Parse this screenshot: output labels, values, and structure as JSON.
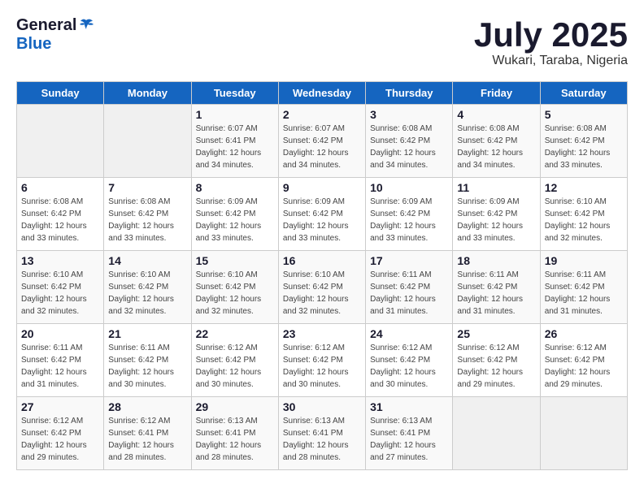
{
  "header": {
    "logo_general": "General",
    "logo_blue": "Blue",
    "month_year": "July 2025",
    "location": "Wukari, Taraba, Nigeria"
  },
  "days_of_week": [
    "Sunday",
    "Monday",
    "Tuesday",
    "Wednesday",
    "Thursday",
    "Friday",
    "Saturday"
  ],
  "weeks": [
    [
      {
        "day": "",
        "info": ""
      },
      {
        "day": "",
        "info": ""
      },
      {
        "day": "1",
        "info": "Sunrise: 6:07 AM\nSunset: 6:41 PM\nDaylight: 12 hours\nand 34 minutes."
      },
      {
        "day": "2",
        "info": "Sunrise: 6:07 AM\nSunset: 6:42 PM\nDaylight: 12 hours\nand 34 minutes."
      },
      {
        "day": "3",
        "info": "Sunrise: 6:08 AM\nSunset: 6:42 PM\nDaylight: 12 hours\nand 34 minutes."
      },
      {
        "day": "4",
        "info": "Sunrise: 6:08 AM\nSunset: 6:42 PM\nDaylight: 12 hours\nand 34 minutes."
      },
      {
        "day": "5",
        "info": "Sunrise: 6:08 AM\nSunset: 6:42 PM\nDaylight: 12 hours\nand 33 minutes."
      }
    ],
    [
      {
        "day": "6",
        "info": "Sunrise: 6:08 AM\nSunset: 6:42 PM\nDaylight: 12 hours\nand 33 minutes."
      },
      {
        "day": "7",
        "info": "Sunrise: 6:08 AM\nSunset: 6:42 PM\nDaylight: 12 hours\nand 33 minutes."
      },
      {
        "day": "8",
        "info": "Sunrise: 6:09 AM\nSunset: 6:42 PM\nDaylight: 12 hours\nand 33 minutes."
      },
      {
        "day": "9",
        "info": "Sunrise: 6:09 AM\nSunset: 6:42 PM\nDaylight: 12 hours\nand 33 minutes."
      },
      {
        "day": "10",
        "info": "Sunrise: 6:09 AM\nSunset: 6:42 PM\nDaylight: 12 hours\nand 33 minutes."
      },
      {
        "day": "11",
        "info": "Sunrise: 6:09 AM\nSunset: 6:42 PM\nDaylight: 12 hours\nand 33 minutes."
      },
      {
        "day": "12",
        "info": "Sunrise: 6:10 AM\nSunset: 6:42 PM\nDaylight: 12 hours\nand 32 minutes."
      }
    ],
    [
      {
        "day": "13",
        "info": "Sunrise: 6:10 AM\nSunset: 6:42 PM\nDaylight: 12 hours\nand 32 minutes."
      },
      {
        "day": "14",
        "info": "Sunrise: 6:10 AM\nSunset: 6:42 PM\nDaylight: 12 hours\nand 32 minutes."
      },
      {
        "day": "15",
        "info": "Sunrise: 6:10 AM\nSunset: 6:42 PM\nDaylight: 12 hours\nand 32 minutes."
      },
      {
        "day": "16",
        "info": "Sunrise: 6:10 AM\nSunset: 6:42 PM\nDaylight: 12 hours\nand 32 minutes."
      },
      {
        "day": "17",
        "info": "Sunrise: 6:11 AM\nSunset: 6:42 PM\nDaylight: 12 hours\nand 31 minutes."
      },
      {
        "day": "18",
        "info": "Sunrise: 6:11 AM\nSunset: 6:42 PM\nDaylight: 12 hours\nand 31 minutes."
      },
      {
        "day": "19",
        "info": "Sunrise: 6:11 AM\nSunset: 6:42 PM\nDaylight: 12 hours\nand 31 minutes."
      }
    ],
    [
      {
        "day": "20",
        "info": "Sunrise: 6:11 AM\nSunset: 6:42 PM\nDaylight: 12 hours\nand 31 minutes."
      },
      {
        "day": "21",
        "info": "Sunrise: 6:11 AM\nSunset: 6:42 PM\nDaylight: 12 hours\nand 30 minutes."
      },
      {
        "day": "22",
        "info": "Sunrise: 6:12 AM\nSunset: 6:42 PM\nDaylight: 12 hours\nand 30 minutes."
      },
      {
        "day": "23",
        "info": "Sunrise: 6:12 AM\nSunset: 6:42 PM\nDaylight: 12 hours\nand 30 minutes."
      },
      {
        "day": "24",
        "info": "Sunrise: 6:12 AM\nSunset: 6:42 PM\nDaylight: 12 hours\nand 30 minutes."
      },
      {
        "day": "25",
        "info": "Sunrise: 6:12 AM\nSunset: 6:42 PM\nDaylight: 12 hours\nand 29 minutes."
      },
      {
        "day": "26",
        "info": "Sunrise: 6:12 AM\nSunset: 6:42 PM\nDaylight: 12 hours\nand 29 minutes."
      }
    ],
    [
      {
        "day": "27",
        "info": "Sunrise: 6:12 AM\nSunset: 6:42 PM\nDaylight: 12 hours\nand 29 minutes."
      },
      {
        "day": "28",
        "info": "Sunrise: 6:12 AM\nSunset: 6:41 PM\nDaylight: 12 hours\nand 28 minutes."
      },
      {
        "day": "29",
        "info": "Sunrise: 6:13 AM\nSunset: 6:41 PM\nDaylight: 12 hours\nand 28 minutes."
      },
      {
        "day": "30",
        "info": "Sunrise: 6:13 AM\nSunset: 6:41 PM\nDaylight: 12 hours\nand 28 minutes."
      },
      {
        "day": "31",
        "info": "Sunrise: 6:13 AM\nSunset: 6:41 PM\nDaylight: 12 hours\nand 27 minutes."
      },
      {
        "day": "",
        "info": ""
      },
      {
        "day": "",
        "info": ""
      }
    ]
  ]
}
